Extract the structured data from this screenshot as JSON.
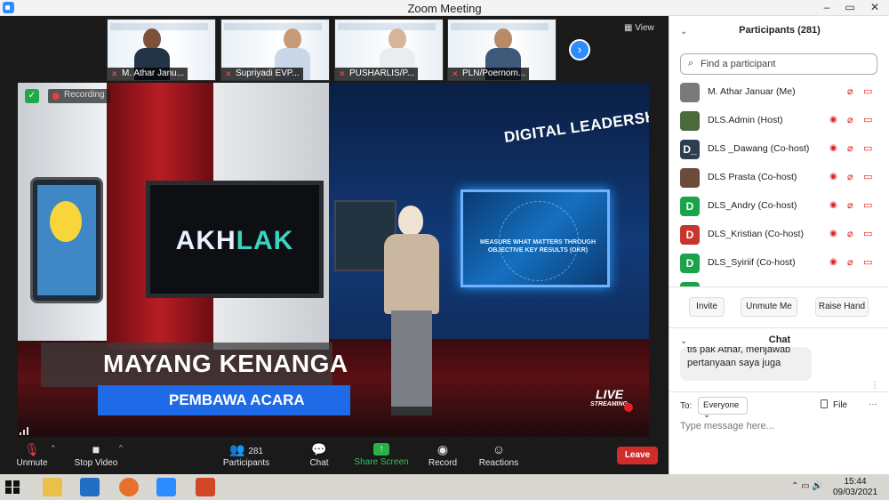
{
  "window": {
    "title": "Zoom Meeting",
    "controls": [
      "–",
      "▭",
      "✕"
    ]
  },
  "gallery": {
    "participants": [
      {
        "name": "M. Athar Janu..."
      },
      {
        "name": "Supriyadi EVP..."
      },
      {
        "name": "PUSHARLIS/P..."
      },
      {
        "name": "PLN/Poernom..."
      }
    ],
    "view_label": "View"
  },
  "main_video": {
    "recording_label": "Recording",
    "series_title": "DIGITAL LEADERSHIP SERIES",
    "screen_left_text_1": "AKH",
    "screen_left_text_2": "LAK",
    "screen_right_text": "MEASURE WHAT MATTERS THROUGH OBJECTIVE KEY RESULTS (OKR)",
    "presenter_name": "MAYANG KENANGA",
    "presenter_role": "PEMBAWA ACARA",
    "live_label": "LIVE",
    "streaming_label": "STREAMING"
  },
  "toolbar": {
    "unmute": "Unmute",
    "stop_video": "Stop Video",
    "participants": "Participants",
    "participants_count": "281",
    "chat": "Chat",
    "share_screen": "Share Screen",
    "record": "Record",
    "reactions": "Reactions",
    "leave": "Leave"
  },
  "sidebar": {
    "participants_title": "Participants (281)",
    "search_placeholder": "Find a participant",
    "participants": [
      {
        "name": "M. Athar Januar (Me)",
        "avatar": "",
        "color": "#7a7a7a"
      },
      {
        "name": "DLS.Admin (Host)",
        "avatar": "",
        "color": "#4b6b3c"
      },
      {
        "name": "DLS _Dawang (Co-host)",
        "avatar": "D_",
        "color": "#2d3e50"
      },
      {
        "name": "DLS Prasta (Co-host)",
        "avatar": "",
        "color": "#6b4b3a"
      },
      {
        "name": "DLS_Andry (Co-host)",
        "avatar": "D",
        "color": "#1aa34a"
      },
      {
        "name": "DLS_Kristian (Co-host)",
        "avatar": "D",
        "color": "#c8352f"
      },
      {
        "name": "DLS_Syiriif (Co-host)",
        "avatar": "D",
        "color": "#1aa34a"
      }
    ],
    "buttons": {
      "invite": "Invite",
      "unmute_me": "Unmute Me",
      "raise_hand": "Raise Hand"
    },
    "chat_title": "Chat",
    "chat_message": "tis pak Athar, menjawab pertanyaan saya juga",
    "to_label": "To:",
    "to_value": "Everyone",
    "file_label": "File",
    "message_placeholder": "Type message here..."
  },
  "taskbar": {
    "time": "15:44",
    "date": "09/03/2021"
  }
}
